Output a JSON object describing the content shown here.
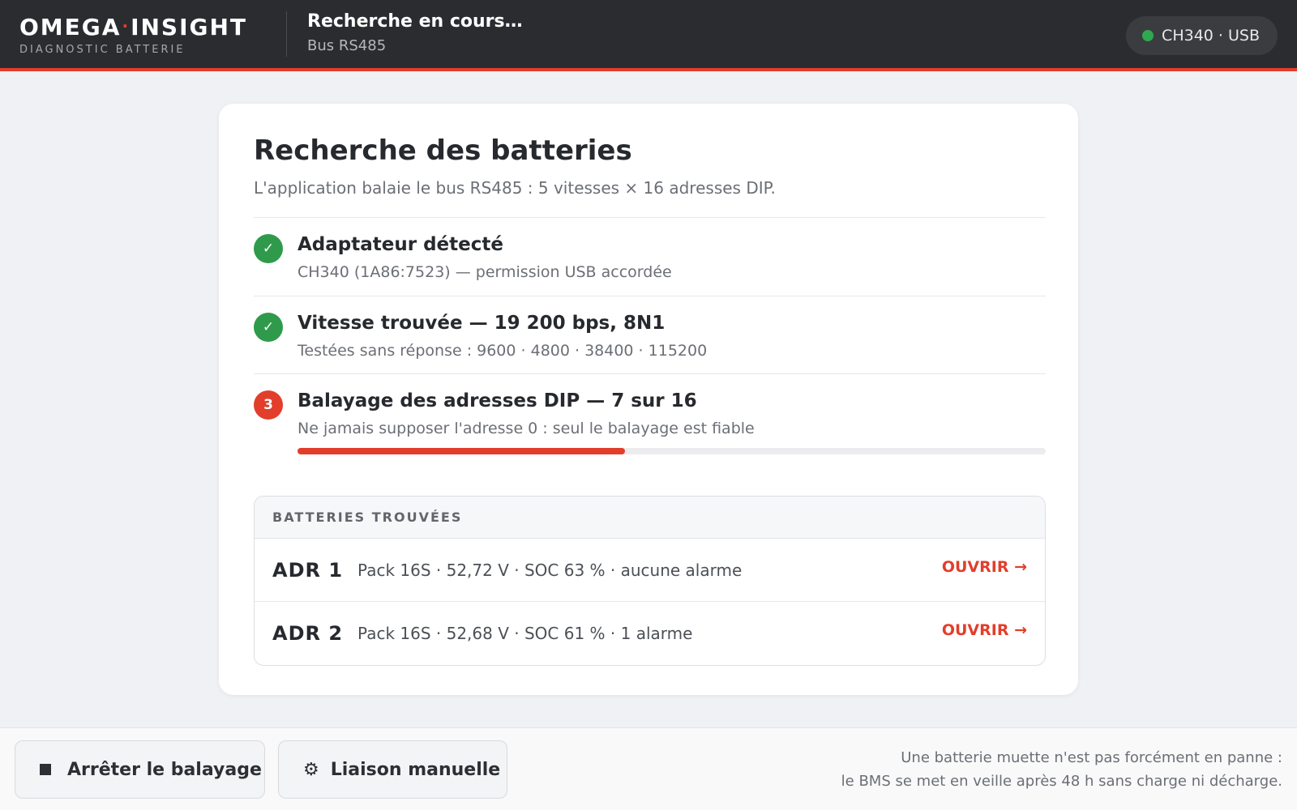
{
  "header": {
    "logo_left": "OMEGA",
    "logo_dot": "·",
    "logo_right": "INSIGHT",
    "logo_sub": "DIAGNOSTIC BATTERIE",
    "title": "Recherche en cours…",
    "subtitle": "Bus RS485",
    "connection": {
      "label": "CH340 · USB",
      "status_color": "#2fa84f"
    }
  },
  "card": {
    "title": "Recherche des batteries",
    "subtitle": "L'application balaie le bus RS485 : 5 vitesses × 16 adresses DIP.",
    "steps": [
      {
        "state": "done",
        "badge": "✓",
        "title": "Adaptateur détecté",
        "subtitle": "CH340 (1A86:7523) — permission USB accordée"
      },
      {
        "state": "done",
        "badge": "✓",
        "title": "Vitesse trouvée — 19 200 bps, 8N1",
        "subtitle": "Testées sans réponse : 9600 · 4800 · 38400 · 115200"
      },
      {
        "state": "active",
        "badge": "3",
        "title": "Balayage des adresses DIP — 7 sur 16",
        "subtitle": "Ne jamais supposer l'adresse 0 : seul le balayage est fiable",
        "progress": 0.4375
      }
    ],
    "found": {
      "heading": "BATTERIES TROUVÉES",
      "items": [
        {
          "adr": "ADR 1",
          "desc": "Pack 16S · 52,72 V · SOC 63 % · aucune alarme",
          "action": "OUVRIR →"
        },
        {
          "adr": "ADR 2",
          "desc": "Pack 16S · 52,68 V · SOC 61 % · 1 alarme",
          "action": "OUVRIR →"
        }
      ]
    }
  },
  "footer": {
    "stop_label": "Arrêter le balayage",
    "manual_label": "Liaison manuelle",
    "note_line1": "Une batterie muette n'est pas forcément en panne :",
    "note_line2": "le BMS se met en veille après 48 h sans charge ni décharge."
  },
  "icons": {
    "stop": "stop-icon",
    "gear": "gear-icon",
    "check": "check-icon",
    "status": "status-dot-icon"
  },
  "colors": {
    "accent": "#e23e2b",
    "success": "#2f9a4c",
    "header_bg": "#2b2c2f"
  }
}
